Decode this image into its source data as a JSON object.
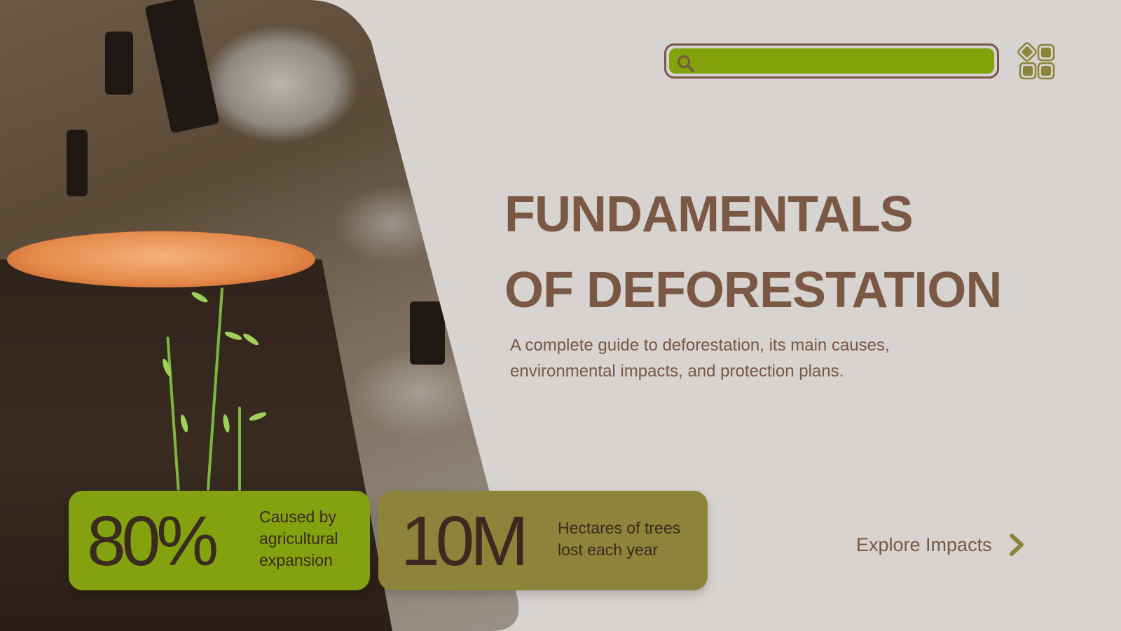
{
  "search": {
    "placeholder": "",
    "value": ""
  },
  "hero": {
    "title_line1": "FUNDAMENTALS",
    "title_line2": "OF DEFORESTATION",
    "subtitle": "A complete guide to deforestation, its main causes, environmental impacts, and protection plans."
  },
  "stats": [
    {
      "value": "80%",
      "desc_line1": "Caused by",
      "desc_line2": "agricultural",
      "desc_line3": "expansion"
    },
    {
      "value": "10M",
      "desc_line1": "Hectares of trees",
      "desc_line2": "lost each year"
    }
  ],
  "cta": {
    "label": "Explore Impacts"
  },
  "colors": {
    "background": "#d6d3d1",
    "brown": "#7a5844",
    "green": "#84a10f",
    "olive": "#8b843a"
  },
  "icons": [
    "search-icon",
    "grid-menu-icon",
    "chevron-right-icon"
  ]
}
